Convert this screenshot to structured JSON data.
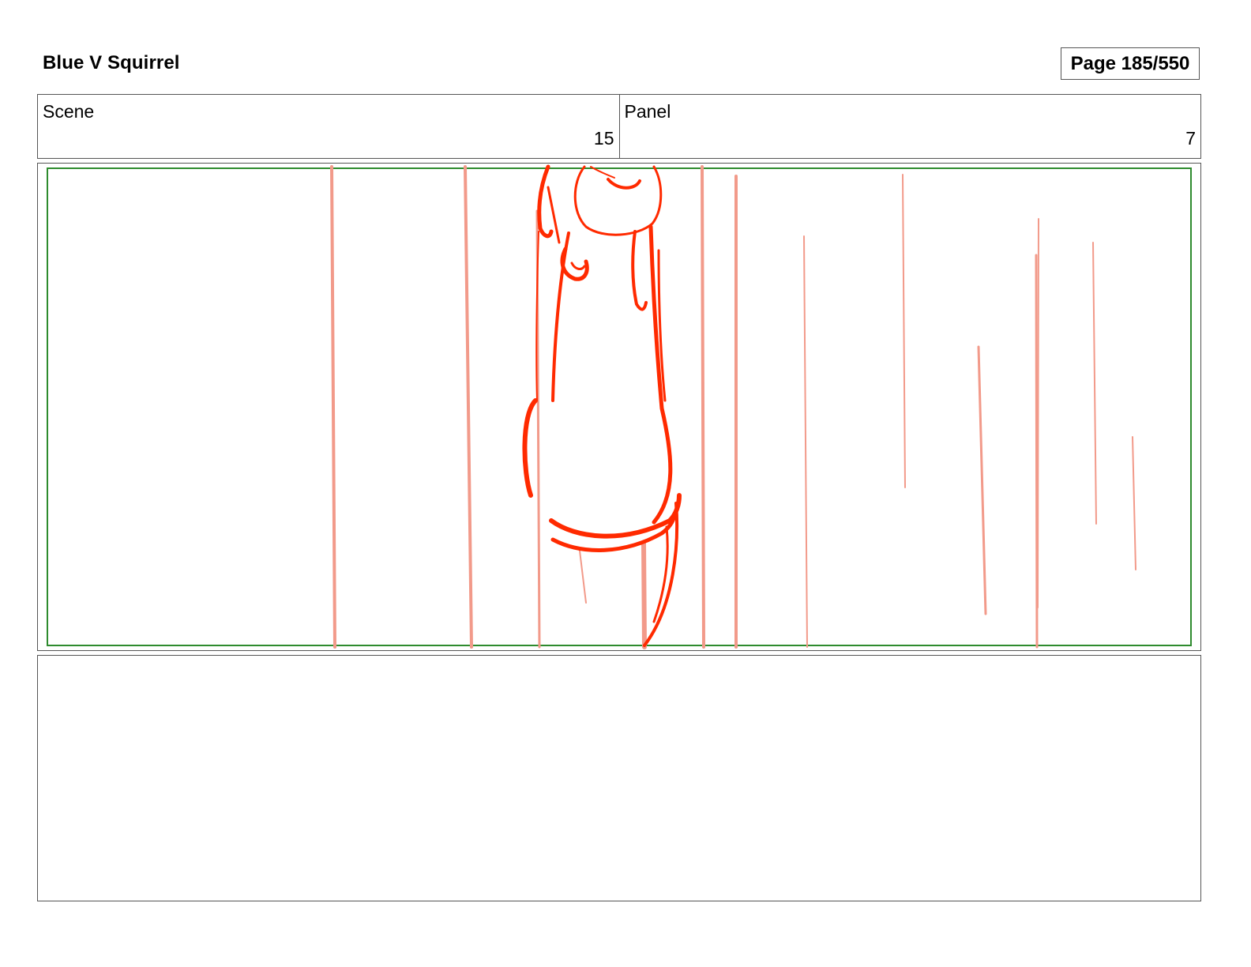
{
  "header": {
    "title": "Blue V Squirrel",
    "page_label": "Page 185/550"
  },
  "info": {
    "scene_label": "Scene",
    "scene_value": "15",
    "panel_label": "Panel",
    "panel_value": "7"
  },
  "colors": {
    "safe_frame": "#2e8b2e",
    "sketch_line": "#ff2a00",
    "rain_line": "#f29a8a",
    "border": "#555555"
  },
  "notes": {
    "text": ""
  }
}
